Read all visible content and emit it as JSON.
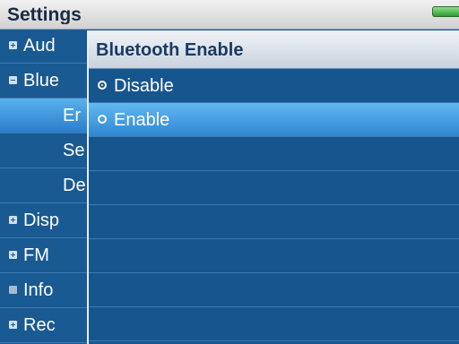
{
  "header": {
    "title": "Settings"
  },
  "menu": {
    "items": [
      {
        "label": "Aud",
        "bullet": "plus"
      },
      {
        "label": "Blue",
        "bullet": "minus"
      },
      {
        "label": "Er",
        "bullet": "none",
        "sub": true,
        "active": true
      },
      {
        "label": "Se",
        "bullet": "none",
        "sub": true
      },
      {
        "label": "De",
        "bullet": "none",
        "sub": true
      },
      {
        "label": "Disp",
        "bullet": "plus"
      },
      {
        "label": "FM",
        "bullet": "plus"
      },
      {
        "label": "Info",
        "bullet": "dim"
      },
      {
        "label": "Rec",
        "bullet": "plus"
      }
    ]
  },
  "dialog": {
    "title": "Bluetooth Enable",
    "options": [
      {
        "label": "Disable",
        "checked": true
      },
      {
        "label": "Enable",
        "checked": false,
        "highlighted": true
      }
    ]
  }
}
